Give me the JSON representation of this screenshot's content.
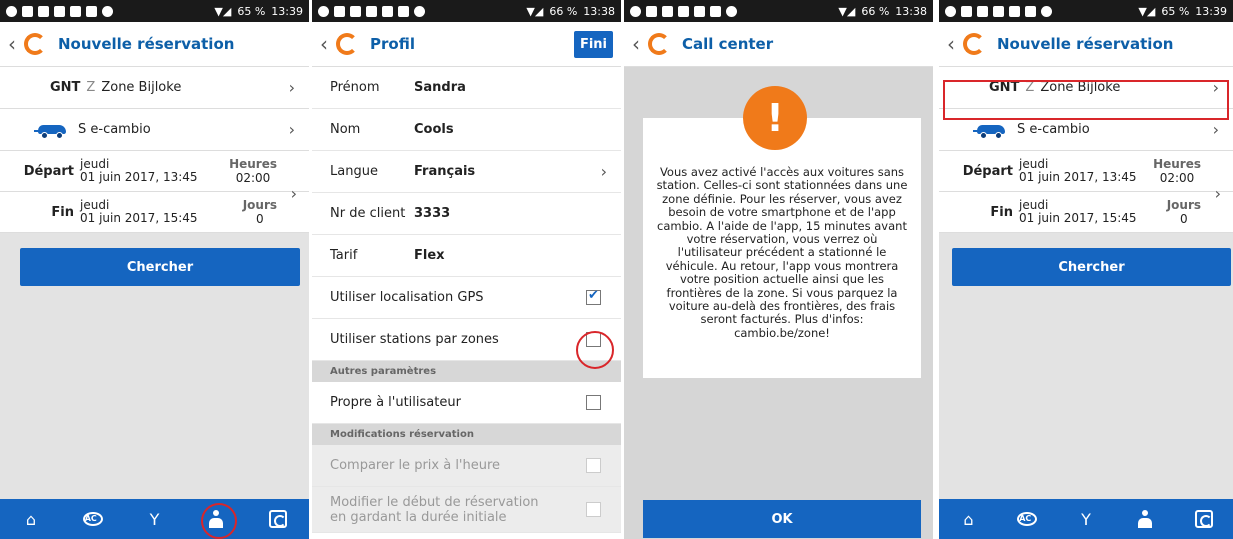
{
  "screens": [
    {
      "status": {
        "battery": "65 %",
        "time": "13:39"
      },
      "title": "Nouvelle réservation",
      "location": {
        "code": "GNT",
        "zone_letter": "Z",
        "name": "Zone Bijloke"
      },
      "car": {
        "name": "S e-cambio"
      },
      "departure": {
        "label": "Départ",
        "day": "jeudi",
        "date": "01 juin 2017, 13:45",
        "side_label": "Heures",
        "side_value": "02:00"
      },
      "end": {
        "label": "Fin",
        "day": "jeudi",
        "date": "01 juin 2017, 15:45",
        "side_label": "Jours",
        "side_value": "0"
      },
      "search_label": "Chercher"
    },
    {
      "status": {
        "battery": "66 %",
        "time": "13:38"
      },
      "title": "Profil",
      "done_label": "Fini",
      "rows": [
        {
          "key": "Prénom",
          "value": "Sandra"
        },
        {
          "key": "Nom",
          "value": "Cools"
        },
        {
          "key": "Langue",
          "value": "Français"
        },
        {
          "key": "Nr de client",
          "value": "3333"
        },
        {
          "key": "Tarif",
          "value": "Flex"
        }
      ],
      "gps_label": "Utiliser localisation GPS",
      "zones_label": "Utiliser stations par zones",
      "section_other": "Autres paramètres",
      "owner_label": "Propre à l'utilisateur",
      "section_mod": "Modifications réservation",
      "compare_label": "Comparer le prix à l'heure",
      "modify_label": "Modifier le début de réservation en gardant la durée initiale"
    },
    {
      "status": {
        "battery": "66 %",
        "time": "13:38"
      },
      "title": "Call center",
      "message": "Vous avez activé l'accès aux voitures sans station. Celles-ci sont stationnées dans une zone définie. Pour les réserver, vous avez besoin de votre smartphone et de l'app cambio. A l'aide de l'app, 15 minutes avant votre réservation, vous verrez où l'utilisateur précédent a stationné le véhicule. Au retour, l'app vous montrera votre position actuelle ainsi que les frontières de la zone. Si vous parquez la voiture au-delà des frontières, des frais seront facturés. Plus d'infos: cambio.be/zone!",
      "ok_label": "OK"
    },
    {
      "status": {
        "battery": "65 %",
        "time": "13:39"
      },
      "title": "Nouvelle réservation",
      "location": {
        "code": "GNT",
        "zone_letter": "Z",
        "name": "Zone Bijloke"
      },
      "car": {
        "name": "S e-cambio"
      },
      "departure": {
        "label": "Départ",
        "day": "jeudi",
        "date": "01 juin 2017, 13:45",
        "side_label": "Heures",
        "side_value": "02:00"
      },
      "end": {
        "label": "Fin",
        "day": "jeudi",
        "date": "01 juin 2017, 15:45",
        "side_label": "Jours",
        "side_value": "0"
      },
      "search_label": "Chercher"
    }
  ],
  "nav": {
    "ac_icon_text": "AC"
  },
  "colors": {
    "primary": "#1565c0",
    "brand_orange": "#f07a1a",
    "highlight": "#d9262a"
  }
}
